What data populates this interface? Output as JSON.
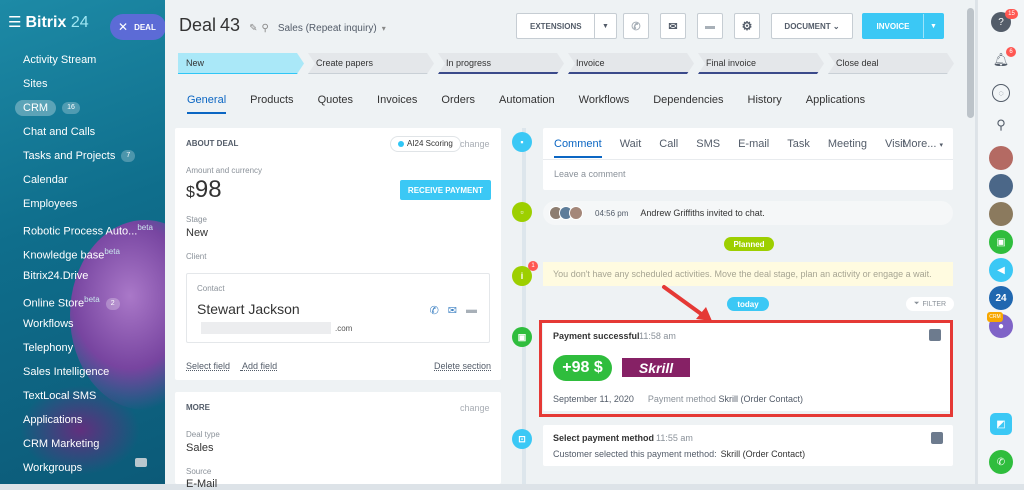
{
  "brand": {
    "name": "Bitrix",
    "num": "24",
    "menu_icon": "hamburger-icon"
  },
  "deal_button": {
    "label": "DEAL",
    "icon": "close-icon"
  },
  "sidebar": {
    "items": [
      {
        "label": "Activity Stream"
      },
      {
        "label": "Sites"
      },
      {
        "label": "CRM",
        "count": "16",
        "active": true
      },
      {
        "label": "Chat and Calls"
      },
      {
        "label": "Tasks and Projects",
        "count": "7"
      },
      {
        "label": "Calendar"
      },
      {
        "label": "Employees"
      },
      {
        "label": "Robotic Process Auto...",
        "sup": "beta"
      },
      {
        "label": "Knowledge base",
        "sup": "beta"
      },
      {
        "label": "Bitrix24.Drive"
      },
      {
        "label": "Online Store",
        "sup": "beta",
        "count": "2"
      },
      {
        "label": "Workflows"
      },
      {
        "label": "Telephony"
      },
      {
        "label": "Sales Intelligence"
      },
      {
        "label": "TextLocal SMS"
      },
      {
        "label": "Applications"
      },
      {
        "label": "CRM Marketing"
      },
      {
        "label": "Workgroups"
      }
    ]
  },
  "header": {
    "title": "Deal",
    "number": "43",
    "subtitle": "Sales (Repeat inquiry)",
    "extensions_label": "EXTENSIONS",
    "document_label": "DOCUMENT",
    "invoice_label": "INVOICE"
  },
  "stages": [
    {
      "label": "New",
      "state": "active"
    },
    {
      "label": "Create papers",
      "state": ""
    },
    {
      "label": "In progress",
      "state": "dark"
    },
    {
      "label": "Invoice",
      "state": "dark"
    },
    {
      "label": "Final invoice",
      "state": "dark"
    },
    {
      "label": "Close deal",
      "state": ""
    }
  ],
  "tabs": [
    {
      "label": "General",
      "active": true
    },
    {
      "label": "Products"
    },
    {
      "label": "Quotes"
    },
    {
      "label": "Invoices"
    },
    {
      "label": "Orders"
    },
    {
      "label": "Automation"
    },
    {
      "label": "Workflows"
    },
    {
      "label": "Dependencies"
    },
    {
      "label": "History"
    },
    {
      "label": "Applications"
    }
  ],
  "about": {
    "heading": "ABOUT DEAL",
    "scoring": "AI24 Scoring",
    "change": "change",
    "amount_label": "Amount and currency",
    "currency_symbol": "$",
    "amount": "98",
    "receive_label": "RECEIVE PAYMENT",
    "stage_label": "Stage",
    "stage_value": "New",
    "client_label": "Client",
    "contact_label": "Contact",
    "contact_name": "Stewart Jackson",
    "email_suffix": ".com",
    "select_field": "Select field",
    "add_field": "Add field",
    "delete_section": "Delete section"
  },
  "more_section": {
    "heading": "MORE",
    "change": "change",
    "deal_type_label": "Deal type",
    "deal_type_value": "Sales",
    "source_label": "Source",
    "source_value": "E-Mail"
  },
  "composer": {
    "tabs": [
      "Comment",
      "Wait",
      "Call",
      "SMS",
      "E-mail",
      "Task",
      "Meeting",
      "Visit"
    ],
    "more": "More...",
    "placeholder": "Leave a comment"
  },
  "chat_event": {
    "time": "04:56 pm",
    "text": "Andrew Griffiths invited to chat."
  },
  "planned_label": "Planned",
  "no_activities": "You don't have any scheduled activities. Move the deal stage, plan an activity or engage a wait.",
  "no_activities_badge": "1",
  "today_label": "today",
  "filter_label": "FILTER",
  "payment": {
    "title": "Payment successful",
    "time": "11:58 am",
    "amount": "+98 $",
    "provider": "Skrill",
    "date": "September 11, 2020",
    "method_label": "Payment method",
    "method_value": "Skrill (Order Contact)"
  },
  "select_method": {
    "title": "Select payment method",
    "time": "11:55 am",
    "text": "Customer selected this payment method:",
    "value": "Skrill (Order Contact)"
  },
  "right_panel": {
    "help_badge": "15",
    "notif_badge": "6",
    "crm_tag": "CRM",
    "b24": "24"
  },
  "colors": {
    "accent": "#3bc8f5",
    "link": "#0b66c3",
    "success": "#2fbd3d",
    "highlight": "#e53935",
    "skrill": "#862165"
  }
}
